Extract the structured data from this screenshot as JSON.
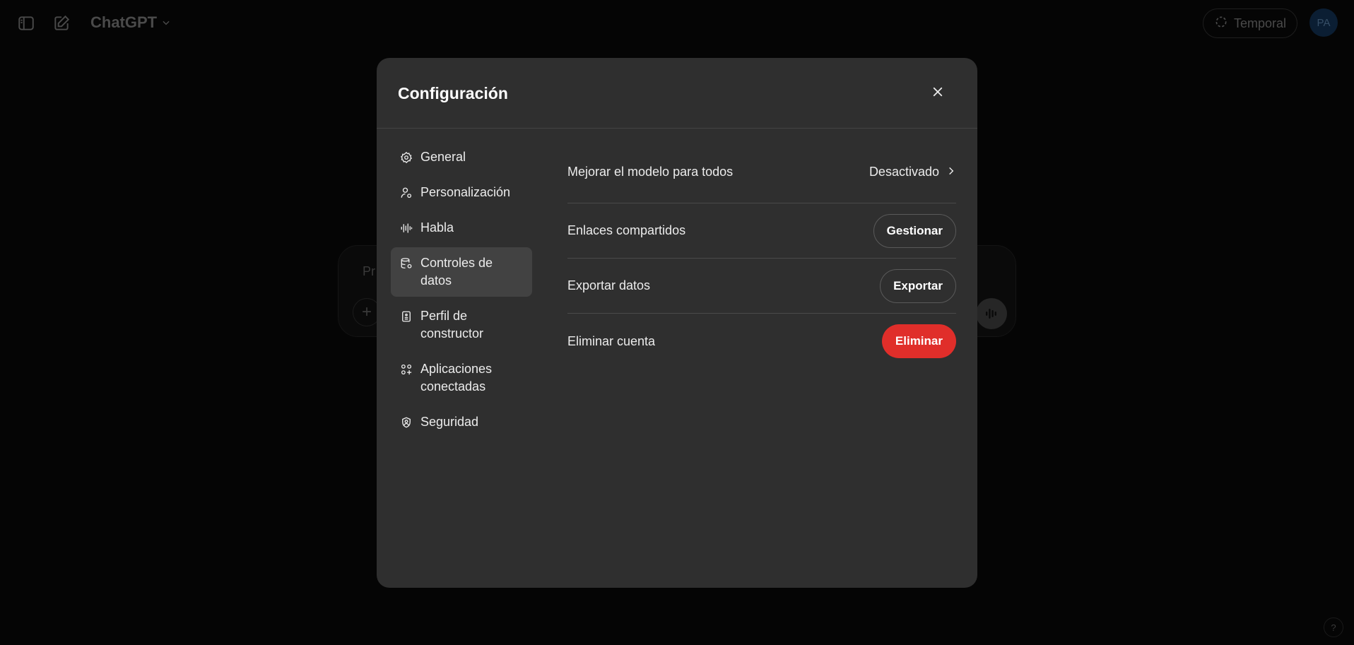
{
  "app": {
    "title": "ChatGPT",
    "temporal_label": "Temporal",
    "avatar_initials": "PA",
    "composer_placeholder": "Pr",
    "help_label": "?"
  },
  "settings": {
    "title": "Configuración",
    "nav": [
      {
        "label": "General",
        "icon": "gear-icon"
      },
      {
        "label": "Personalización",
        "icon": "person-icon"
      },
      {
        "label": "Habla",
        "icon": "waveform-icon"
      },
      {
        "label": "Controles de datos",
        "icon": "database-icon",
        "active": true
      },
      {
        "label": "Perfil de constructor",
        "icon": "id-card-icon"
      },
      {
        "label": "Aplicaciones conectadas",
        "icon": "apps-icon"
      },
      {
        "label": "Seguridad",
        "icon": "shield-icon"
      }
    ],
    "rows": [
      {
        "label": "Mejorar el modelo para todos",
        "value": "Desactivado"
      },
      {
        "label": "Enlaces compartidos",
        "action": "Gestionar"
      },
      {
        "label": "Exportar datos",
        "action": "Exportar"
      },
      {
        "label": "Eliminar cuenta",
        "action": "Eliminar"
      }
    ]
  },
  "colors": {
    "modal_bg": "#2f2f2f",
    "danger": "#e02e2a",
    "active_nav": "#424242"
  }
}
